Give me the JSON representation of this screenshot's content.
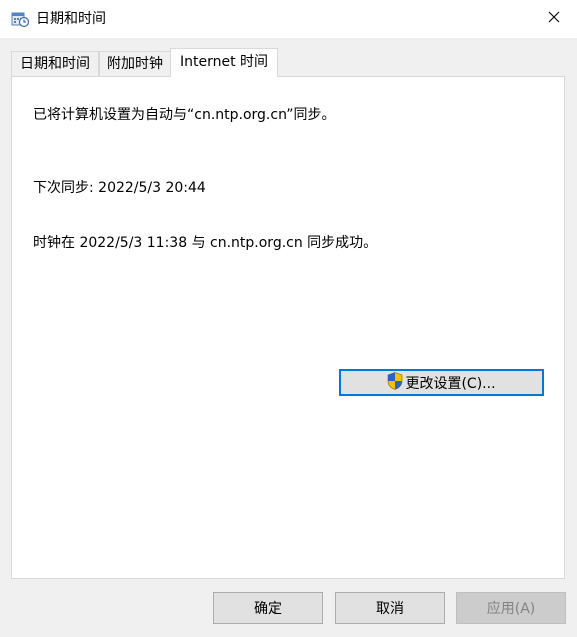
{
  "window": {
    "title": "日期和时间",
    "app_icon": "date-time-icon",
    "close_icon": "close-icon"
  },
  "tabs": [
    {
      "label": "日期和时间"
    },
    {
      "label": "附加时钟"
    },
    {
      "label": "Internet 时间",
      "active": true
    }
  ],
  "internet_time": {
    "status_text": "已将计算机设置为自动与“cn.ntp.org.cn”同步。",
    "next_sync": "下次同步: 2022/5/3 20:44",
    "last_sync": "时钟在 2022/5/3 11:38 与 cn.ntp.org.cn 同步成功。",
    "change_settings_label": "更改设置(C)...",
    "shield_icon": "uac-shield-icon"
  },
  "buttons": {
    "ok_label": "确定",
    "cancel_label": "取消",
    "apply_label": "应用(A)"
  },
  "colors": {
    "focus_border": "#0078d7",
    "dialog_background": "#f0f0f0",
    "panel_background": "#ffffff"
  }
}
